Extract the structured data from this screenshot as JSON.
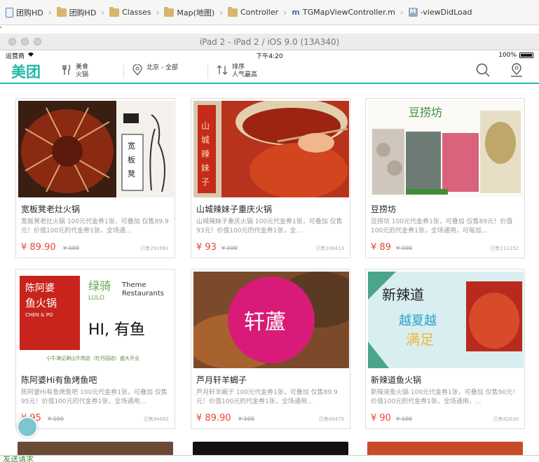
{
  "breadcrumb": {
    "items": [
      {
        "label": "团购HD",
        "icon": "file-icon"
      },
      {
        "label": "团购HD",
        "icon": "folder-icon"
      },
      {
        "label": "Classes",
        "icon": "folder-icon"
      },
      {
        "label": "Map(地图)",
        "icon": "folder-icon"
      },
      {
        "label": "Controller",
        "icon": "folder-icon"
      },
      {
        "label": "TGMapViewController.m",
        "icon": "m-file-icon"
      },
      {
        "label": "-viewDidLoad",
        "icon": "method-icon"
      }
    ]
  },
  "simulator": {
    "title": "iPad 2 - iPad 2 / iOS 9.0 (13A340)"
  },
  "statusbar": {
    "carrier": "运营商",
    "time": "下午4:20",
    "battery": "100%"
  },
  "navbar": {
    "logo": "美团",
    "items": [
      {
        "line1": "美食",
        "line2": "火锅",
        "icon": "utensils-icon"
      },
      {
        "line1": "北京 - 全部",
        "line2": "",
        "icon": "location-pin-icon"
      },
      {
        "line1": "排序",
        "line2": "人气最高",
        "icon": "sort-icon"
      }
    ],
    "right_icons": [
      "search-icon",
      "map-pin-icon"
    ]
  },
  "deals": [
    {
      "name": "宽板凳老灶火锅",
      "desc": "宽板凳老灶火锅 100元代金券1张，可叠加 仅售89.9元！价值100元的代金券1张，全场通...",
      "price": "¥ 89.90",
      "orig": "¥ 100",
      "sold": "已售291661"
    },
    {
      "name": "山城辣妹子重庆火锅",
      "desc": "山城辣妹子重庆火锅 100元代金券1张，可叠加 仅售93元！价值100元的代金券1张，全...",
      "price": "¥ 93",
      "orig": "¥ 100",
      "sold": "已售206413"
    },
    {
      "name": "豆捞坊",
      "desc": "豆捞坊 100元代金券1张，可叠加 仅售89元！价值100元的代金券1张，全场通用，可每加...",
      "price": "¥ 89",
      "orig": "¥ 100",
      "sold": "已售111252"
    },
    {
      "name": "陈阿婆Hi有鱼烤鱼吧",
      "desc": "陈阿婆Hi有鱼烤鱼吧 100元代金券1张，可叠加 仅售95元！价值100元的代金券1张，全场通用...",
      "price": "¥ 95",
      "orig": "¥ 100",
      "sold": "已售94692"
    },
    {
      "name": "芦月轩羊蝎子",
      "desc": "芦月轩羊蝎子 100元代金券1张，可叠加 仅售89.9元！价值100元的代金券1张，全场通用...",
      "price": "¥ 89.90",
      "orig": "¥ 100",
      "sold": "已售89475"
    },
    {
      "name": "新辣道鱼火锅",
      "desc": "新辣道鱼火锅 100元代金券1张，可叠加 仅售90元！价值100元的代金券1张，全场通用，...",
      "price": "¥ 90",
      "orig": "¥ 100",
      "sold": "已售82630"
    }
  ],
  "console": {
    "text": "发送请求"
  },
  "colors": {
    "brand": "#21b8a8",
    "price": "#e8472e"
  }
}
